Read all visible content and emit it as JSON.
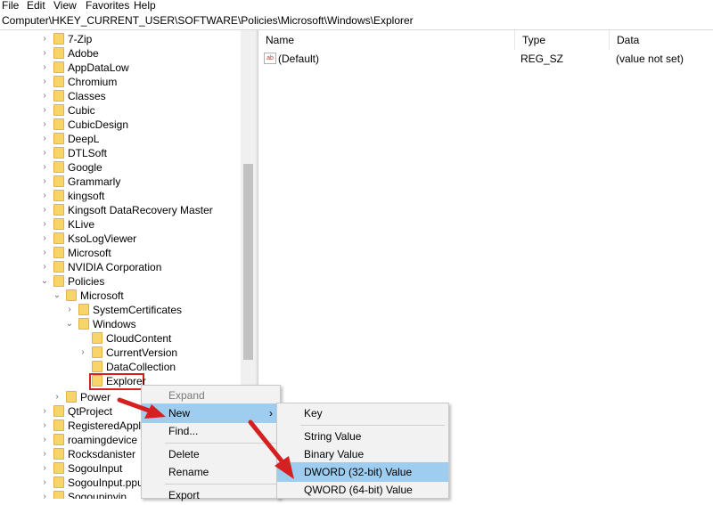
{
  "menu": [
    "File",
    "Edit",
    "View",
    "Favorites",
    "Help"
  ],
  "address": "Computer\\HKEY_CURRENT_USER\\SOFTWARE\\Policies\\Microsoft\\Windows\\Explorer",
  "tree": [
    {
      "label": "7-Zip",
      "state": "collapsed"
    },
    {
      "label": "Adobe",
      "state": "collapsed"
    },
    {
      "label": "AppDataLow",
      "state": "collapsed"
    },
    {
      "label": "Chromium",
      "state": "collapsed"
    },
    {
      "label": "Classes",
      "state": "collapsed"
    },
    {
      "label": "Cubic",
      "state": "collapsed"
    },
    {
      "label": "CubicDesign",
      "state": "collapsed"
    },
    {
      "label": "DeepL",
      "state": "collapsed"
    },
    {
      "label": "DTLSoft",
      "state": "collapsed"
    },
    {
      "label": "Google",
      "state": "collapsed"
    },
    {
      "label": "Grammarly",
      "state": "collapsed"
    },
    {
      "label": "kingsoft",
      "state": "collapsed"
    },
    {
      "label": "Kingsoft DataRecovery Master",
      "state": "collapsed"
    },
    {
      "label": "KLive",
      "state": "collapsed"
    },
    {
      "label": "KsoLogViewer",
      "state": "collapsed"
    },
    {
      "label": "Microsoft",
      "state": "collapsed"
    },
    {
      "label": "NVIDIA Corporation",
      "state": "collapsed"
    },
    {
      "label": "Policies",
      "state": "expanded"
    },
    {
      "label": "Microsoft",
      "state": "expanded"
    },
    {
      "label": "SystemCertificates",
      "state": "collapsed"
    },
    {
      "label": "Windows",
      "state": "expanded"
    },
    {
      "label": "CloudContent",
      "state": "leaf"
    },
    {
      "label": "CurrentVersion",
      "state": "collapsed"
    },
    {
      "label": "DataCollection",
      "state": "leaf"
    },
    {
      "label": "Explorer",
      "state": "selected"
    },
    {
      "label": "Power",
      "state": "collapsed"
    },
    {
      "label": "QtProject",
      "state": "collapsed"
    },
    {
      "label": "RegisteredApplica",
      "state": "collapsed"
    },
    {
      "label": "roamingdevice",
      "state": "collapsed"
    },
    {
      "label": "Rocksdanister",
      "state": "collapsed"
    },
    {
      "label": "SogouInput",
      "state": "collapsed"
    },
    {
      "label": "SogouInput.ppup",
      "state": "collapsed"
    },
    {
      "label": "Sogoupinyin",
      "state": "collapsed"
    }
  ],
  "columns": {
    "name": "Name",
    "type": "Type",
    "data": "Data"
  },
  "values": [
    {
      "icon": "string-value-icon",
      "name": "(Default)",
      "type": "REG_SZ",
      "data": "(value not set)"
    }
  ],
  "context_menu": {
    "expand": "Expand",
    "new": "New",
    "find": "Find...",
    "delete": "Delete",
    "rename": "Rename",
    "export": "Export"
  },
  "submenu": {
    "key": "Key",
    "string_value": "String Value",
    "binary_value": "Binary Value",
    "dword_value": "DWORD (32-bit) Value",
    "qword_value": "QWORD (64-bit) Value"
  },
  "colors": {
    "highlight": "#9fcdf0",
    "annotation_red": "#d42020",
    "folder": "#f8d56a"
  }
}
